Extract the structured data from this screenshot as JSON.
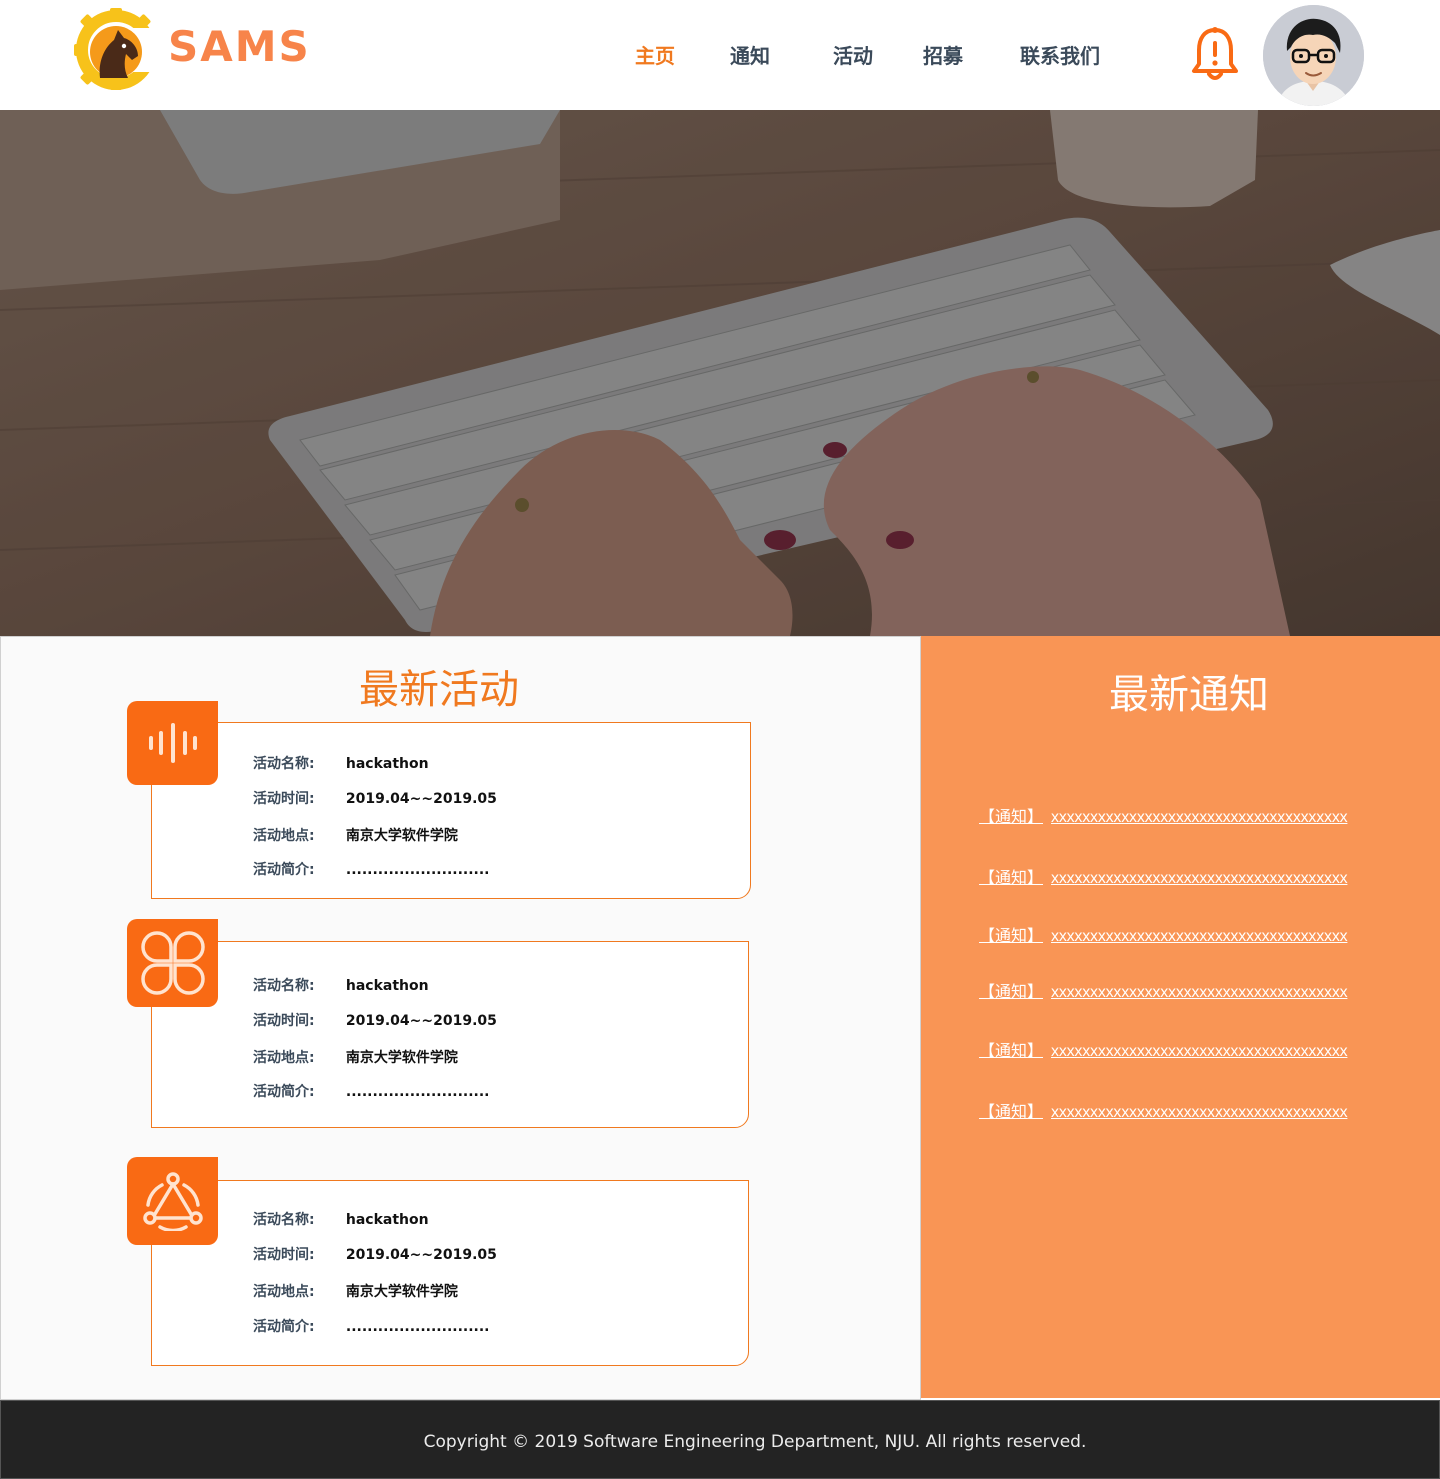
{
  "brand": {
    "name": "SAMS",
    "accent": "#f7844a",
    "primary": "#f0791f"
  },
  "nav": {
    "items": [
      {
        "label": "主页",
        "active": true
      },
      {
        "label": "通知",
        "active": false
      },
      {
        "label": "活动",
        "active": false
      },
      {
        "label": "招募",
        "active": false
      },
      {
        "label": "联系我们",
        "active": false
      }
    ]
  },
  "header": {
    "bell_icon": "bell-alert-icon",
    "avatar_icon": "user-avatar-icon"
  },
  "activities": {
    "title": "最新活动",
    "labels": {
      "name": "活动名称:",
      "time": "活动时间:",
      "place": "活动地点:",
      "intro": "活动简介:"
    },
    "items": [
      {
        "icon": "sound-wave-icon",
        "name": "hackathon",
        "time": "2019.04~~2019.05",
        "place": "南京大学软件学院",
        "intro": "..........................."
      },
      {
        "icon": "clover-icon",
        "name": "hackathon",
        "time": "2019.04~~2019.05",
        "place": "南京大学软件学院",
        "intro": "..........................."
      },
      {
        "icon": "network-icon",
        "name": "hackathon",
        "time": "2019.04~~2019.05",
        "place": "南京大学软件学院",
        "intro": "..........................."
      }
    ]
  },
  "notices": {
    "title": "最新通知",
    "items": [
      {
        "tag": "【通知】",
        "text": "xxxxxxxxxxxxxxxxxxxxxxxxxxxxxxxxxxxxxx"
      },
      {
        "tag": "【通知】",
        "text": "xxxxxxxxxxxxxxxxxxxxxxxxxxxxxxxxxxxxxx"
      },
      {
        "tag": "【通知】",
        "text": "xxxxxxxxxxxxxxxxxxxxxxxxxxxxxxxxxxxxxx"
      },
      {
        "tag": "【通知】",
        "text": "xxxxxxxxxxxxxxxxxxxxxxxxxxxxxxxxxxxxxx"
      },
      {
        "tag": "【通知】",
        "text": "xxxxxxxxxxxxxxxxxxxxxxxxxxxxxxxxxxxxxx"
      },
      {
        "tag": "【通知】",
        "text": "xxxxxxxxxxxxxxxxxxxxxxxxxxxxxxxxxxxxxx"
      }
    ]
  },
  "footer": {
    "copyright": "Copyright © 2019 Software Engineering Department, NJU. All rights reserved."
  }
}
